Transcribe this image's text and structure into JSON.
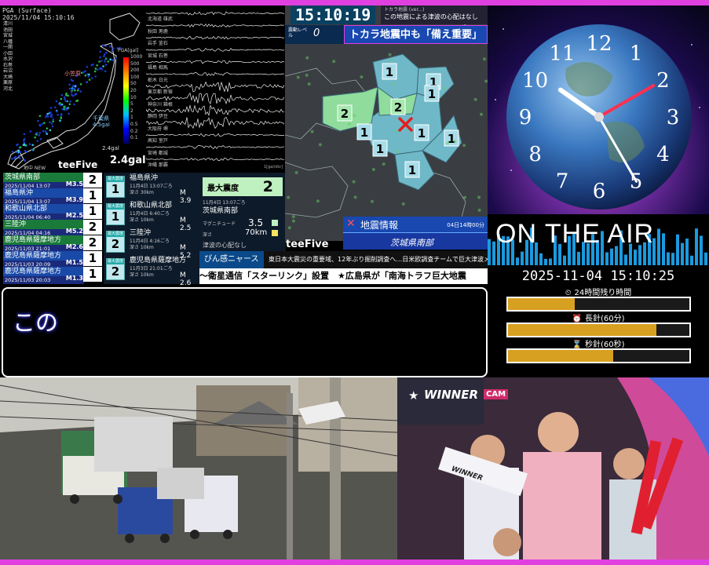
{
  "pga_panel": {
    "timestamp_lines": [
      "PGA (Surface)",
      "2025/11/04 15:10:16"
    ],
    "station_list": [
      "清川",
      "池田",
      "宮城",
      "八幡",
      "一関",
      "小田",
      "水沢",
      "石巻",
      "岩沼",
      "大崎",
      "栗原",
      "河北"
    ],
    "scale_title": "PGA[gal]",
    "scale_labels": [
      "1000",
      "500",
      "200",
      "100",
      "50",
      "20",
      "10",
      "5",
      "2",
      "1",
      "0.5",
      "0.2",
      "0.1"
    ],
    "callout_1": "小笠原",
    "callout_2": "千葉県\n4.5gal",
    "gal_small": "2.4gal",
    "gal_big": "2.4gal",
    "brand": "teeFive",
    "source": "地中 NEW"
  },
  "wave_panel": {
    "labels": [
      "北海道 雄武",
      "秋田 男鹿",
      "岩手 釜石",
      "宮城 石巻",
      "福島 相馬",
      "栃木 日光",
      "東京都 新宿",
      "神奈川 箱根",
      "静岡 伊豆",
      "大阪府 堺",
      "高知 室戸",
      "宮崎 都城",
      "沖縄 那覇"
    ],
    "unit": "1[gal/div]"
  },
  "quake_list": [
    {
      "name": "茨城県南部",
      "date": "2025/11/04 13:07",
      "mag": "M3.5",
      "intensity": "2",
      "color": "#1a7a3a"
    },
    {
      "name": "福島県沖",
      "date": "2025/11/04 13:07",
      "mag": "M3.9",
      "intensity": "1",
      "color": "#1a4aa8"
    },
    {
      "name": "和歌山県北部",
      "date": "2025/11/04 06:40",
      "mag": "M2.5",
      "intensity": "1",
      "color": "#1a4aa8"
    },
    {
      "name": "三陸沖",
      "date": "2025/11/04 04:16",
      "mag": "M5.2",
      "intensity": "2",
      "color": "#1a7a3a"
    },
    {
      "name": "鹿児島県薩摩地方",
      "date": "2025/11/03 21:01",
      "mag": "M2.6",
      "intensity": "2",
      "color": "#1a7a3a"
    },
    {
      "name": "鹿児島県薩摩地方",
      "date": "2025/11/03 20:09",
      "mag": "M1.5",
      "intensity": "1",
      "color": "#1a4aa8"
    },
    {
      "name": "鹿児島県薩摩地方",
      "date": "2025/11/03 20:03",
      "mag": "M1.3",
      "intensity": "1",
      "color": "#1a4aa8"
    }
  ],
  "detail_list": [
    {
      "small": "最大震度",
      "int": "1",
      "name": "福島県沖",
      "meta": "11月4日 13:07ごろ\n深さ 30km",
      "mag": "M 3.9"
    },
    {
      "small": "最大震度",
      "int": "1",
      "name": "和歌山県北部",
      "meta": "11月4日 6:40ごろ\n深さ 10km",
      "mag": "M 2.5"
    },
    {
      "small": "最大震度",
      "int": "2",
      "name": "三陸沖",
      "meta": "11月4日 4:16ごろ\n深さ 10km",
      "mag": "M 5.2"
    },
    {
      "small": "最大震度",
      "int": "2",
      "name": "鹿児島県薩摩地方",
      "meta": "11月3日 21:01ごろ\n深さ 10km",
      "mag": "M 2.6"
    }
  ],
  "max_panel": {
    "label": "最大震度",
    "value": "2",
    "time": "11月4日 13:07ごろ",
    "place": "茨城県南部",
    "mag_label": "マグニチュード",
    "mag_value": "3.5",
    "depth_label": "深さ",
    "depth_value": "70km",
    "tsunami": "津波の心配なし"
  },
  "tv": {
    "clock": "15:10:19",
    "scroll_top": "この地震による津波の心配はなし",
    "scroll_top_sub": "トカラ地震 (ver...)",
    "level_label": "震動レベル",
    "level_value": "0",
    "headline": "トカラ地震中も「備え重要」",
    "map_numbers": [
      "1",
      "1",
      "2",
      "2",
      "1",
      "1",
      "1",
      "1",
      "1",
      "1"
    ],
    "brand": "teeFive",
    "eq_title": "地震情報",
    "eq_time": "04日14時00分",
    "eq_place": "茨城県南部"
  },
  "ticker1": {
    "tag": "ぴん感ニャース",
    "text": "東日本大震災の重要域、12年ぶり掘削調査へ…日米欧調査チームで巨大津波メカニズム解明目指す"
  },
  "ticker2": {
    "text": "～衛星通信「スターリンク」設置　★広島県が「南海トラフ巨大地震"
  },
  "caption": {
    "text": "この"
  },
  "clock_panel": {
    "numerals": [
      "12",
      "1",
      "2",
      "3",
      "4",
      "5",
      "6",
      "7",
      "8",
      "9",
      "10",
      "11"
    ],
    "hour_angle": 305,
    "minute_angle": 60,
    "second_angle": 150
  },
  "onair": {
    "text": "ON THE AIR"
  },
  "datetime": "2025-11-04 15:10:25",
  "bars": [
    {
      "label": "24時間残り時間",
      "icon": "timer-icon",
      "fraction": 0.37
    },
    {
      "label": "長針(60分)",
      "icon": "clock-icon",
      "fraction": 0.82
    },
    {
      "label": "秒針(60秒)",
      "icon": "hourglass-icon",
      "fraction": 0.58
    }
  ],
  "winner_cam": {
    "brand": "WINNER",
    "cam": "CAM",
    "towel": "WINNER"
  }
}
